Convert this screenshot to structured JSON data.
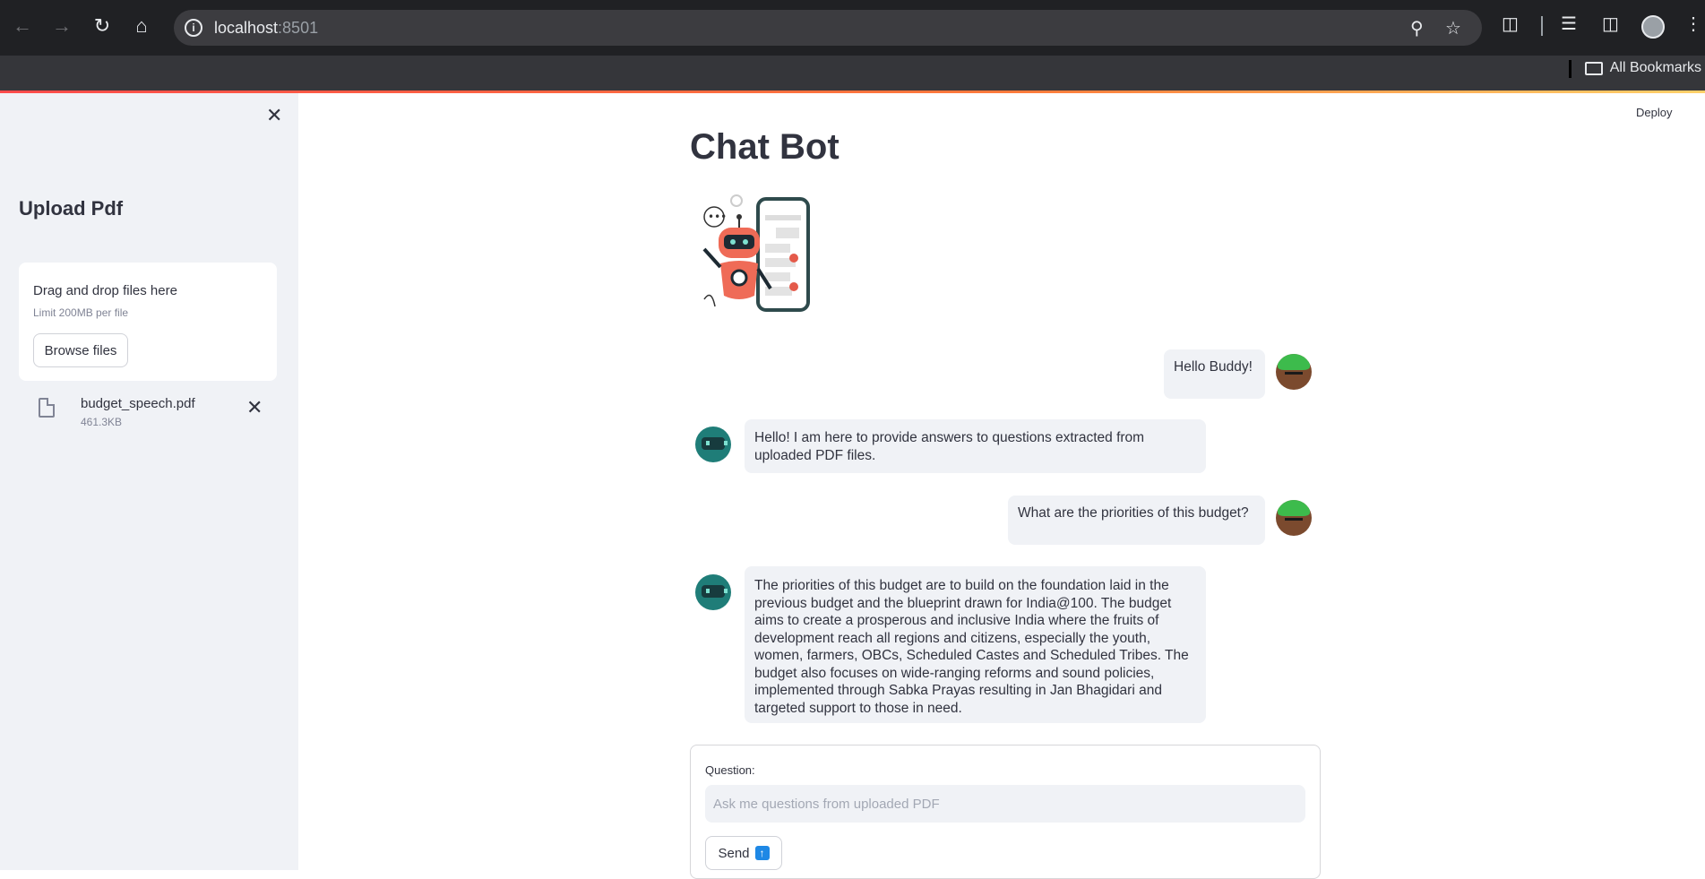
{
  "browser": {
    "url_host": "localhost",
    "url_port": ":8501",
    "bookmarks_label": "All Bookmarks"
  },
  "sidebar": {
    "title": "Upload Pdf",
    "dropzone_title": "Drag and drop files here",
    "dropzone_limit": "Limit 200MB per file",
    "browse_label": "Browse files",
    "file": {
      "name": "budget_speech.pdf",
      "size": "461.3KB"
    }
  },
  "header": {
    "deploy_label": "Deploy"
  },
  "main": {
    "title": "Chat Bot",
    "messages": [
      {
        "role": "user",
        "text": "Hello Buddy!"
      },
      {
        "role": "bot",
        "text": "Hello! I am here to provide answers to questions extracted from uploaded PDF files."
      },
      {
        "role": "user",
        "text": "What are the priorities of this budget?"
      },
      {
        "role": "bot",
        "text": "The priorities of this budget are to build on the foundation laid in the previous budget and the blueprint drawn for India@100. The budget aims to create a prosperous and inclusive India where the fruits of development reach all regions and citizens, especially the youth, women, farmers, OBCs, Scheduled Castes and Scheduled Tribes. The budget also focuses on wide-ranging reforms and sound policies, implemented through Sabka Prayas resulting in Jan Bhagidari and targeted support to those in need."
      }
    ],
    "form": {
      "question_label": "Question:",
      "question_placeholder": "Ask me questions from uploaded PDF",
      "question_value": "",
      "send_label": "Send"
    }
  },
  "colors": {
    "accent": "#ff4b4b",
    "sidebar_bg": "#f0f2f6",
    "text": "#31333f"
  }
}
